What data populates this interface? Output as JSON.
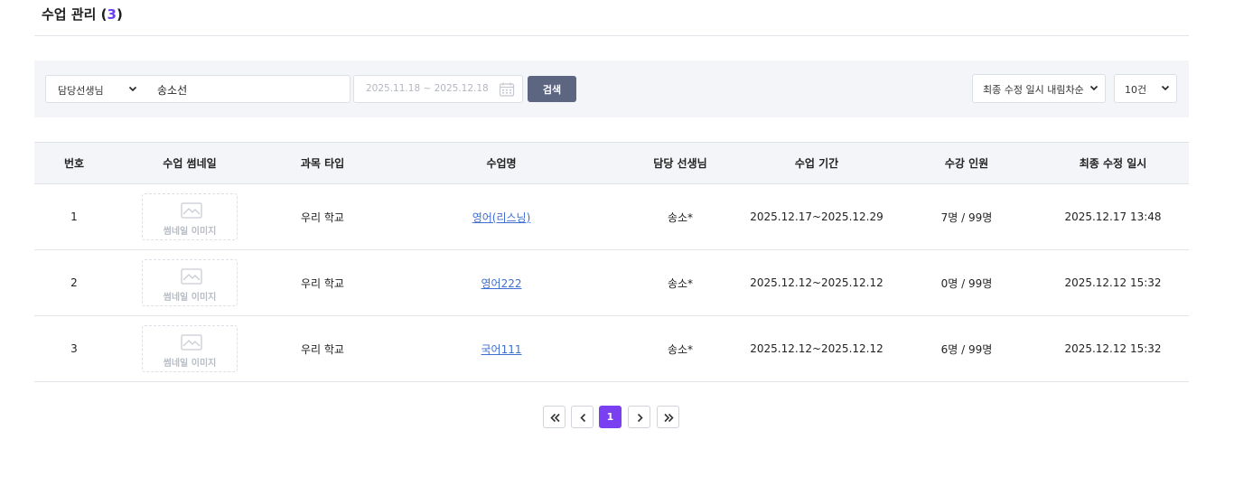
{
  "header": {
    "title": "수업 관리",
    "count_open": "(",
    "count": "3",
    "count_close": ")"
  },
  "filters": {
    "teacher_select_label": "담당선생님",
    "teacher_input_value": "송소선",
    "date_range": "2025.11.18 ~ 2025.12.18",
    "search_button": "검색",
    "sort_select": "최종 수정 일시 내림차순",
    "page_size_select": "10건"
  },
  "table": {
    "columns": [
      "번호",
      "수업 썸네일",
      "과목 타입",
      "수업명",
      "담당 선생님",
      "수업 기간",
      "수강 인원",
      "최종 수정 일시"
    ],
    "thumbnail_placeholder": "썸네일 이미지",
    "rows": [
      {
        "no": "1",
        "type": "우리 학교",
        "name": "영어(리스닝)",
        "teacher": "송소*",
        "period": "2025.12.17~2025.12.29",
        "enrollment": "7명 / 99명",
        "updated": "2025.12.17 13:48"
      },
      {
        "no": "2",
        "type": "우리 학교",
        "name": "영어222",
        "teacher": "송소*",
        "period": "2025.12.12~2025.12.12",
        "enrollment": "0명 / 99명",
        "updated": "2025.12.12 15:32"
      },
      {
        "no": "3",
        "type": "우리 학교",
        "name": "국어111",
        "teacher": "송소*",
        "period": "2025.12.12~2025.12.12",
        "enrollment": "6명 / 99명",
        "updated": "2025.12.12 15:32"
      }
    ]
  },
  "pagination": {
    "current_page": "1",
    "icons": [
      "first-page-icon",
      "prev-page-icon",
      "next-page-icon",
      "last-page-icon"
    ]
  },
  "colors": {
    "accent": "#7b3ff2",
    "search_button": "#5d6681",
    "link": "#3f6fd1"
  }
}
